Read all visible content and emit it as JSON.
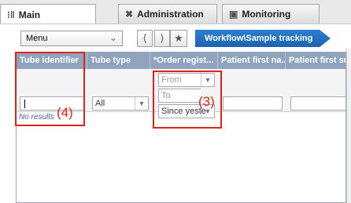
{
  "tabs": [
    {
      "label": "Main",
      "icon": "chart-icon",
      "active": true
    },
    {
      "label": "Administration",
      "icon": "tools-icon",
      "active": false
    },
    {
      "label": "Monitoring",
      "icon": "monitor-icon",
      "active": false
    }
  ],
  "toolbar": {
    "menu_label": "Menu",
    "breadcrumb": "Workflow\\Sample tracking"
  },
  "grid": {
    "columns": [
      "Tube identifier",
      "Tube type",
      "*Order regist...",
      "Patient first na...",
      "Patient first su"
    ],
    "filters": {
      "tube_type_value": "All",
      "from_placeholder": "From",
      "to_placeholder": "To",
      "order_range_value": "Since yeste"
    },
    "no_results": "No results"
  },
  "callouts": {
    "c3": "(3)",
    "c4": "(4)"
  },
  "colors": {
    "header": "#8fa5bf",
    "breadcrumb": "#1d63b1",
    "highlight": "#e2231a"
  }
}
